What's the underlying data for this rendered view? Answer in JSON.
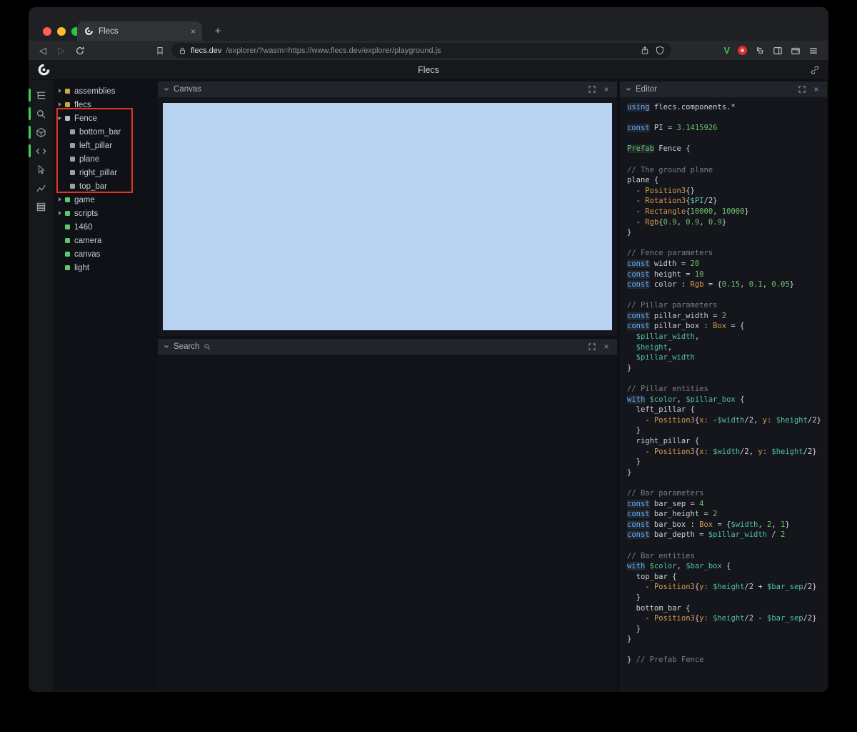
{
  "glyphs": {
    "close": "×",
    "new_tab": "+",
    "back": "◁",
    "forward": "▷"
  },
  "colors": {
    "accent_green": "#43d15c",
    "canvas_blue": "#b7d3f1",
    "annotation_red": "#e33227",
    "entity_yellow": "#cfa93c",
    "entity_green": "#5bc96c",
    "entity_gray": "#9aa1a9"
  },
  "browser": {
    "tab_title": "Flecs",
    "url_domain": "flecs.dev",
    "url_path": "/explorer/?wasm=https://www.flecs.dev/explorer/playground.js"
  },
  "app": {
    "title": "Flecs"
  },
  "sidebar": {
    "icons": [
      {
        "name": "entity-tree-icon",
        "active": true
      },
      {
        "name": "query-search-icon",
        "active": true
      },
      {
        "name": "entity-inspector-icon",
        "active": true
      },
      {
        "name": "script-editor-icon",
        "active": true
      },
      {
        "name": "canvas-pointer-icon",
        "active": false
      },
      {
        "name": "stats-chart-icon",
        "active": false
      },
      {
        "name": "memory-icon",
        "active": false
      }
    ]
  },
  "panels": {
    "canvas": {
      "title": "Canvas"
    },
    "search": {
      "title": "Search"
    },
    "editor": {
      "title": "Editor"
    }
  },
  "tree": {
    "items": [
      {
        "label": "assemblies",
        "arrow": "right",
        "color": "#cfa93c",
        "indent": 0
      },
      {
        "label": "flecs",
        "arrow": "right",
        "color": "#cfa93c",
        "indent": 0
      },
      {
        "label": "Fence",
        "arrow": "down",
        "color": "#b8bdc5",
        "indent": 0
      },
      {
        "label": "bottom_bar",
        "arrow": "",
        "color": "#9aa1a9",
        "indent": 1
      },
      {
        "label": "left_pillar",
        "arrow": "",
        "color": "#9aa1a9",
        "indent": 1
      },
      {
        "label": "plane",
        "arrow": "",
        "color": "#9aa1a9",
        "indent": 1
      },
      {
        "label": "right_pillar",
        "arrow": "",
        "color": "#9aa1a9",
        "indent": 1
      },
      {
        "label": "top_bar",
        "arrow": "",
        "color": "#9aa1a9",
        "indent": 1
      },
      {
        "label": "game",
        "arrow": "right",
        "color": "#5bc96c",
        "indent": 0
      },
      {
        "label": "scripts",
        "arrow": "right",
        "color": "#5bc96c",
        "indent": 0
      },
      {
        "label": "1460",
        "arrow": "",
        "color": "#5bc96c",
        "indent": 0
      },
      {
        "label": "camera",
        "arrow": "",
        "color": "#5bc96c",
        "indent": 0
      },
      {
        "label": "canvas",
        "arrow": "",
        "color": "#5bc96c",
        "indent": 0
      },
      {
        "label": "light",
        "arrow": "",
        "color": "#5bc96c",
        "indent": 0
      }
    ]
  },
  "editor": {
    "lines": [
      [
        [
          "k",
          "using"
        ],
        [
          "w",
          " flecs.components.*"
        ]
      ],
      [],
      [
        [
          "k",
          "const"
        ],
        [
          "w",
          " PI = "
        ],
        [
          "n",
          "3.1415926"
        ]
      ],
      [],
      [
        [
          "p",
          "Prefab"
        ],
        [
          "w",
          " Fence {"
        ]
      ],
      [],
      [
        [
          "c",
          "// The ground plane"
        ]
      ],
      [
        [
          "w",
          "plane {"
        ]
      ],
      [
        [
          "w",
          "  - "
        ],
        [
          "t",
          "Position3"
        ],
        [
          "w",
          "{}"
        ]
      ],
      [
        [
          "w",
          "  - "
        ],
        [
          "t",
          "Rotation3"
        ],
        [
          "w",
          "{"
        ],
        [
          "v",
          "$PI"
        ],
        [
          "w",
          "/2}"
        ]
      ],
      [
        [
          "w",
          "  - "
        ],
        [
          "t",
          "Rectangle"
        ],
        [
          "w",
          "{"
        ],
        [
          "n",
          "10000"
        ],
        [
          "w",
          ", "
        ],
        [
          "n",
          "10000"
        ],
        [
          "w",
          "}"
        ]
      ],
      [
        [
          "w",
          "  - "
        ],
        [
          "t",
          "Rgb"
        ],
        [
          "w",
          "{"
        ],
        [
          "n",
          "0.9"
        ],
        [
          "w",
          ", "
        ],
        [
          "n",
          "0.9"
        ],
        [
          "w",
          ", "
        ],
        [
          "n",
          "0.9"
        ],
        [
          "w",
          "}"
        ]
      ],
      [
        [
          "w",
          "}"
        ]
      ],
      [],
      [
        [
          "c",
          "// Fence parameters"
        ]
      ],
      [
        [
          "k",
          "const"
        ],
        [
          "w",
          " width = "
        ],
        [
          "n",
          "20"
        ]
      ],
      [
        [
          "k",
          "const"
        ],
        [
          "w",
          " height = "
        ],
        [
          "n",
          "10"
        ]
      ],
      [
        [
          "k",
          "const"
        ],
        [
          "w",
          " color : "
        ],
        [
          "t",
          "Rgb"
        ],
        [
          "w",
          " = {"
        ],
        [
          "n",
          "0.15"
        ],
        [
          "w",
          ", "
        ],
        [
          "n",
          "0.1"
        ],
        [
          "w",
          ", "
        ],
        [
          "n",
          "0.05"
        ],
        [
          "w",
          "}"
        ]
      ],
      [],
      [
        [
          "c",
          "// Pillar parameters"
        ]
      ],
      [
        [
          "k",
          "const"
        ],
        [
          "w",
          " pillar_width = "
        ],
        [
          "n",
          "2"
        ]
      ],
      [
        [
          "k",
          "const"
        ],
        [
          "w",
          " pillar_box : "
        ],
        [
          "t",
          "Box"
        ],
        [
          "w",
          " = {"
        ]
      ],
      [
        [
          "w",
          "  "
        ],
        [
          "v",
          "$pillar_width"
        ],
        [
          "w",
          ","
        ]
      ],
      [
        [
          "w",
          "  "
        ],
        [
          "v",
          "$height"
        ],
        [
          "w",
          ","
        ]
      ],
      [
        [
          "w",
          "  "
        ],
        [
          "v",
          "$pillar_width"
        ]
      ],
      [
        [
          "w",
          "}"
        ]
      ],
      [],
      [
        [
          "c",
          "// Pillar entities"
        ]
      ],
      [
        [
          "k",
          "with"
        ],
        [
          "w",
          " "
        ],
        [
          "v",
          "$color"
        ],
        [
          "w",
          ", "
        ],
        [
          "v",
          "$pillar_box"
        ],
        [
          "w",
          " {"
        ]
      ],
      [
        [
          "w",
          "  left_pillar {"
        ]
      ],
      [
        [
          "w",
          "    - "
        ],
        [
          "t",
          "Position3"
        ],
        [
          "w",
          "{"
        ],
        [
          "t",
          "x:"
        ],
        [
          "w",
          " -"
        ],
        [
          "v",
          "$width"
        ],
        [
          "w",
          "/2, "
        ],
        [
          "t",
          "y:"
        ],
        [
          "w",
          " "
        ],
        [
          "v",
          "$height"
        ],
        [
          "w",
          "/2}"
        ]
      ],
      [
        [
          "w",
          "  }"
        ]
      ],
      [
        [
          "w",
          "  right_pillar {"
        ]
      ],
      [
        [
          "w",
          "    - "
        ],
        [
          "t",
          "Position3"
        ],
        [
          "w",
          "{"
        ],
        [
          "t",
          "x:"
        ],
        [
          "w",
          " "
        ],
        [
          "v",
          "$width"
        ],
        [
          "w",
          "/2, "
        ],
        [
          "t",
          "y:"
        ],
        [
          "w",
          " "
        ],
        [
          "v",
          "$height"
        ],
        [
          "w",
          "/2}"
        ]
      ],
      [
        [
          "w",
          "  }"
        ]
      ],
      [
        [
          "w",
          "}"
        ]
      ],
      [],
      [
        [
          "c",
          "// Bar parameters"
        ]
      ],
      [
        [
          "k",
          "const"
        ],
        [
          "w",
          " bar_sep = "
        ],
        [
          "n",
          "4"
        ]
      ],
      [
        [
          "k",
          "const"
        ],
        [
          "w",
          " bar_height = "
        ],
        [
          "n",
          "2"
        ]
      ],
      [
        [
          "k",
          "const"
        ],
        [
          "w",
          " bar_box : "
        ],
        [
          "t",
          "Box"
        ],
        [
          "w",
          " = {"
        ],
        [
          "v",
          "$width"
        ],
        [
          "w",
          ", "
        ],
        [
          "n",
          "2"
        ],
        [
          "w",
          ", "
        ],
        [
          "n",
          "1"
        ],
        [
          "w",
          "}"
        ]
      ],
      [
        [
          "k",
          "const"
        ],
        [
          "w",
          " bar_depth = "
        ],
        [
          "v",
          "$pillar_width"
        ],
        [
          "w",
          " / "
        ],
        [
          "n",
          "2"
        ]
      ],
      [],
      [
        [
          "c",
          "// Bar entities"
        ]
      ],
      [
        [
          "k",
          "with"
        ],
        [
          "w",
          " "
        ],
        [
          "v",
          "$color"
        ],
        [
          "w",
          ", "
        ],
        [
          "v",
          "$bar_box"
        ],
        [
          "w",
          " {"
        ]
      ],
      [
        [
          "w",
          "  top_bar {"
        ]
      ],
      [
        [
          "w",
          "    - "
        ],
        [
          "t",
          "Position3"
        ],
        [
          "w",
          "{"
        ],
        [
          "t",
          "y:"
        ],
        [
          "w",
          " "
        ],
        [
          "v",
          "$height"
        ],
        [
          "w",
          "/2 + "
        ],
        [
          "v",
          "$bar_sep"
        ],
        [
          "w",
          "/2}"
        ]
      ],
      [
        [
          "w",
          "  }"
        ]
      ],
      [
        [
          "w",
          "  bottom_bar {"
        ]
      ],
      [
        [
          "w",
          "    - "
        ],
        [
          "t",
          "Position3"
        ],
        [
          "w",
          "{"
        ],
        [
          "t",
          "y:"
        ],
        [
          "w",
          " "
        ],
        [
          "v",
          "$height"
        ],
        [
          "w",
          "/2 - "
        ],
        [
          "v",
          "$bar_sep"
        ],
        [
          "w",
          "/2}"
        ]
      ],
      [
        [
          "w",
          "  }"
        ]
      ],
      [
        [
          "w",
          "}"
        ]
      ],
      [],
      [
        [
          "w",
          "} "
        ],
        [
          "c",
          "// Prefab Fence"
        ]
      ]
    ]
  }
}
